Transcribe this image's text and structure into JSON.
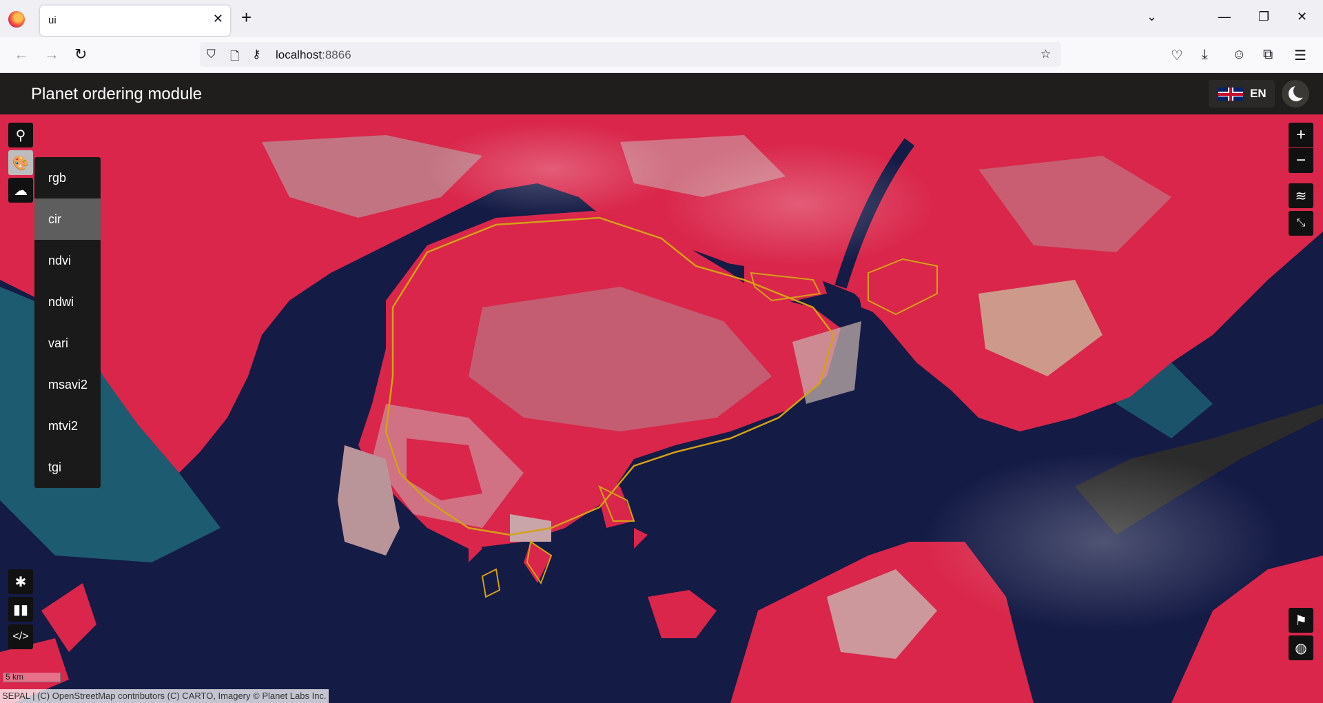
{
  "browser": {
    "tab_title": "ui",
    "url_host": "localhost",
    "url_port": ":8866"
  },
  "app": {
    "title": "Planet ordering module",
    "language": "EN"
  },
  "visualization_menu": {
    "items": [
      "rgb",
      "cir",
      "ndvi",
      "ndwi",
      "vari",
      "msavi2",
      "mtvi2",
      "tgi"
    ],
    "selected": "cir"
  },
  "map": {
    "scale_label": "5 km",
    "attribution": "SEPAL | (C) OpenStreetMap contributors (C) CARTO, Imagery © Planet Labs Inc.",
    "colors": {
      "water": "#141b45",
      "vegetation": "#d9264a",
      "urban": "#b9959a",
      "boundary": "#d4a017"
    }
  },
  "icons": {
    "search": "search-icon",
    "palette": "palette-icon",
    "download": "cloud-download-icon",
    "bug": "bug-icon",
    "book": "book-icon",
    "code": "code-icon",
    "zoom_in": "plus-icon",
    "zoom_out": "minus-icon",
    "layers": "layers-icon",
    "fullscreen": "fullscreen-exit-icon",
    "location": "map-pin-icon",
    "globe": "globe-icon"
  }
}
